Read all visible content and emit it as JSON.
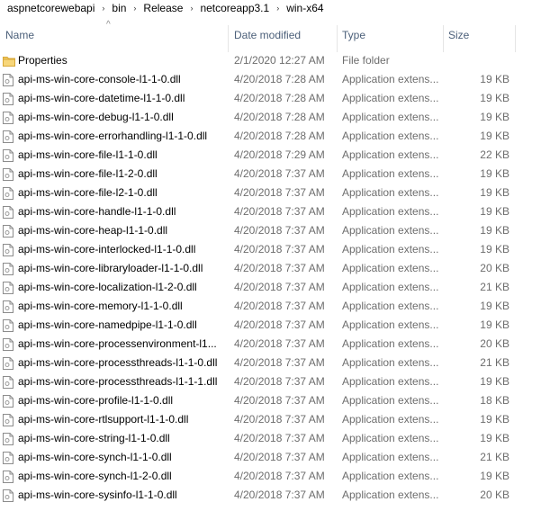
{
  "breadcrumb": [
    "aspnetcorewebapi",
    "bin",
    "Release",
    "netcoreapp3.1",
    "win-x64"
  ],
  "columns": {
    "name": "Name",
    "date": "Date modified",
    "type": "Type",
    "size": "Size"
  },
  "sort_indicator": "^",
  "icons": {
    "folder": "folder-icon",
    "file": "file-icon",
    "separator": "chevron-right-icon"
  },
  "colors": {
    "folder": "#e8b84a",
    "header_text": "#4c607a"
  },
  "files": [
    {
      "name": "Properties",
      "date": "2/1/2020 12:27 AM",
      "type": "File folder",
      "size": "",
      "kind": "folder"
    },
    {
      "name": "api-ms-win-core-console-l1-1-0.dll",
      "date": "4/20/2018 7:28 AM",
      "type": "Application extens...",
      "size": "19 KB",
      "kind": "file"
    },
    {
      "name": "api-ms-win-core-datetime-l1-1-0.dll",
      "date": "4/20/2018 7:28 AM",
      "type": "Application extens...",
      "size": "19 KB",
      "kind": "file"
    },
    {
      "name": "api-ms-win-core-debug-l1-1-0.dll",
      "date": "4/20/2018 7:28 AM",
      "type": "Application extens...",
      "size": "19 KB",
      "kind": "file"
    },
    {
      "name": "api-ms-win-core-errorhandling-l1-1-0.dll",
      "date": "4/20/2018 7:28 AM",
      "type": "Application extens...",
      "size": "19 KB",
      "kind": "file"
    },
    {
      "name": "api-ms-win-core-file-l1-1-0.dll",
      "date": "4/20/2018 7:29 AM",
      "type": "Application extens...",
      "size": "22 KB",
      "kind": "file"
    },
    {
      "name": "api-ms-win-core-file-l1-2-0.dll",
      "date": "4/20/2018 7:37 AM",
      "type": "Application extens...",
      "size": "19 KB",
      "kind": "file"
    },
    {
      "name": "api-ms-win-core-file-l2-1-0.dll",
      "date": "4/20/2018 7:37 AM",
      "type": "Application extens...",
      "size": "19 KB",
      "kind": "file"
    },
    {
      "name": "api-ms-win-core-handle-l1-1-0.dll",
      "date": "4/20/2018 7:37 AM",
      "type": "Application extens...",
      "size": "19 KB",
      "kind": "file"
    },
    {
      "name": "api-ms-win-core-heap-l1-1-0.dll",
      "date": "4/20/2018 7:37 AM",
      "type": "Application extens...",
      "size": "19 KB",
      "kind": "file"
    },
    {
      "name": "api-ms-win-core-interlocked-l1-1-0.dll",
      "date": "4/20/2018 7:37 AM",
      "type": "Application extens...",
      "size": "19 KB",
      "kind": "file"
    },
    {
      "name": "api-ms-win-core-libraryloader-l1-1-0.dll",
      "date": "4/20/2018 7:37 AM",
      "type": "Application extens...",
      "size": "20 KB",
      "kind": "file"
    },
    {
      "name": "api-ms-win-core-localization-l1-2-0.dll",
      "date": "4/20/2018 7:37 AM",
      "type": "Application extens...",
      "size": "21 KB",
      "kind": "file"
    },
    {
      "name": "api-ms-win-core-memory-l1-1-0.dll",
      "date": "4/20/2018 7:37 AM",
      "type": "Application extens...",
      "size": "19 KB",
      "kind": "file"
    },
    {
      "name": "api-ms-win-core-namedpipe-l1-1-0.dll",
      "date": "4/20/2018 7:37 AM",
      "type": "Application extens...",
      "size": "19 KB",
      "kind": "file"
    },
    {
      "name": "api-ms-win-core-processenvironment-l1...",
      "date": "4/20/2018 7:37 AM",
      "type": "Application extens...",
      "size": "20 KB",
      "kind": "file"
    },
    {
      "name": "api-ms-win-core-processthreads-l1-1-0.dll",
      "date": "4/20/2018 7:37 AM",
      "type": "Application extens...",
      "size": "21 KB",
      "kind": "file"
    },
    {
      "name": "api-ms-win-core-processthreads-l1-1-1.dll",
      "date": "4/20/2018 7:37 AM",
      "type": "Application extens...",
      "size": "19 KB",
      "kind": "file"
    },
    {
      "name": "api-ms-win-core-profile-l1-1-0.dll",
      "date": "4/20/2018 7:37 AM",
      "type": "Application extens...",
      "size": "18 KB",
      "kind": "file"
    },
    {
      "name": "api-ms-win-core-rtlsupport-l1-1-0.dll",
      "date": "4/20/2018 7:37 AM",
      "type": "Application extens...",
      "size": "19 KB",
      "kind": "file"
    },
    {
      "name": "api-ms-win-core-string-l1-1-0.dll",
      "date": "4/20/2018 7:37 AM",
      "type": "Application extens...",
      "size": "19 KB",
      "kind": "file"
    },
    {
      "name": "api-ms-win-core-synch-l1-1-0.dll",
      "date": "4/20/2018 7:37 AM",
      "type": "Application extens...",
      "size": "21 KB",
      "kind": "file"
    },
    {
      "name": "api-ms-win-core-synch-l1-2-0.dll",
      "date": "4/20/2018 7:37 AM",
      "type": "Application extens...",
      "size": "19 KB",
      "kind": "file"
    },
    {
      "name": "api-ms-win-core-sysinfo-l1-1-0.dll",
      "date": "4/20/2018 7:37 AM",
      "type": "Application extens...",
      "size": "20 KB",
      "kind": "file"
    }
  ]
}
